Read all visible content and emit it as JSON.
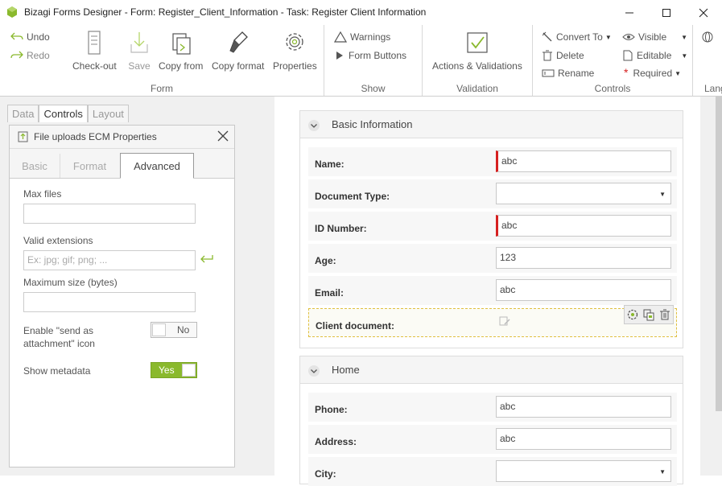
{
  "window": {
    "title": "Bizagi Forms Designer  - Form: Register_Client_Information - Task:  Register Client Information"
  },
  "ribbon": {
    "form_group": {
      "title": "Form",
      "undo": "Undo",
      "redo": "Redo",
      "checkout": "Check-out",
      "save": "Save",
      "copy_from": "Copy from",
      "copy_format": "Copy format",
      "properties": "Properties"
    },
    "show_group": {
      "title": "Show",
      "warnings": "Warnings",
      "form_buttons": "Form Buttons"
    },
    "validation_group": {
      "title": "Validation",
      "actions": "Actions & Validations"
    },
    "controls_group": {
      "title": "Controls",
      "convert_to": "Convert To",
      "delete": "Delete",
      "rename": "Rename",
      "visible": "Visible",
      "editable": "Editable",
      "required": "Required"
    },
    "lang_group": {
      "title": "Lang"
    }
  },
  "left_tabs": [
    "Data",
    "Controls",
    "Layout"
  ],
  "properties": {
    "title": "File uploads ECM Properties",
    "tabs": [
      "Basic",
      "Format",
      "Advanced"
    ],
    "max_files_label": "Max files",
    "max_files_value": "",
    "valid_ext_label": "Valid extensions",
    "valid_ext_placeholder": "Ex:  jpg; gif; png; ...",
    "max_size_label": "Maximum size (bytes)",
    "max_size_value": "",
    "send_attach_label": "Enable \"send as attachment\" icon",
    "send_attach_value": "No",
    "show_metadata_label": "Show metadata",
    "show_metadata_value": "Yes"
  },
  "form": {
    "sections": [
      {
        "title": "Basic Information",
        "rows": [
          {
            "label": "Name:",
            "value": "abc"
          },
          {
            "label": "Document Type:",
            "value": ""
          },
          {
            "label": "ID Number:",
            "value": "abc"
          },
          {
            "label": "Age:",
            "value": "123"
          },
          {
            "label": "Email:",
            "value": "abc"
          },
          {
            "label": "Client document:",
            "value": ""
          }
        ]
      },
      {
        "title": "Home",
        "rows": [
          {
            "label": "Phone:",
            "value": "abc"
          },
          {
            "label": "Address:",
            "value": "abc"
          },
          {
            "label": "City:",
            "value": ""
          }
        ]
      }
    ]
  },
  "colors": {
    "accent": "#8ab92d",
    "required": "#d62020",
    "selection": "#e0c040"
  }
}
